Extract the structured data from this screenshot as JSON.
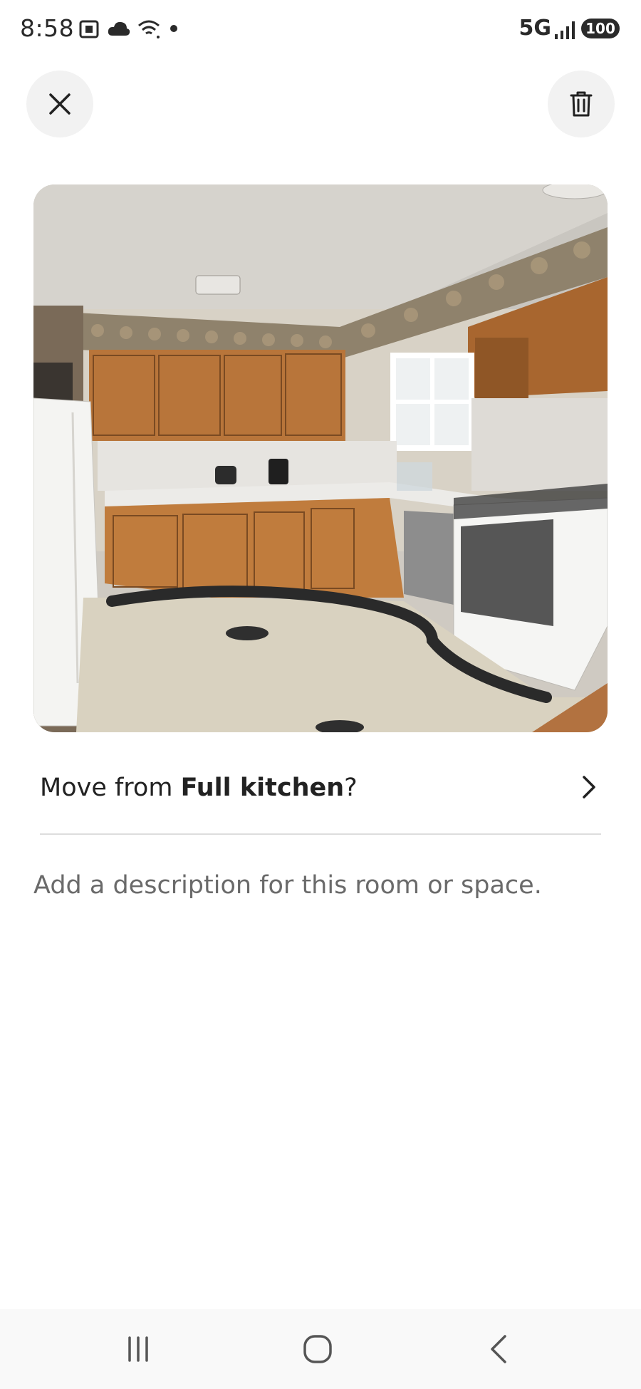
{
  "status_bar": {
    "time": "8:58",
    "network": "5G",
    "battery": "100",
    "left_icons": [
      "screenshot-icon",
      "cloud-icon",
      "wifi-icon",
      "dot-icon"
    ],
    "right_icons": [
      "signal-icon",
      "battery-icon"
    ]
  },
  "toolbar": {
    "close_icon": "close-icon",
    "delete_icon": "trash-icon"
  },
  "photo": {
    "subject": "kitchen photo"
  },
  "move_row": {
    "prefix": "Move from ",
    "room": "Full kitchen",
    "suffix": "?",
    "icon": "chevron-right-icon"
  },
  "description": {
    "placeholder": "Add a description for this room or space."
  },
  "nav_bar": {
    "icons": [
      "recent-apps-icon",
      "home-icon",
      "back-icon"
    ]
  },
  "colors": {
    "text_primary": "#222222",
    "text_secondary": "#6a6a6a",
    "button_bg": "#f2f2f2",
    "divider": "#dddddd"
  }
}
